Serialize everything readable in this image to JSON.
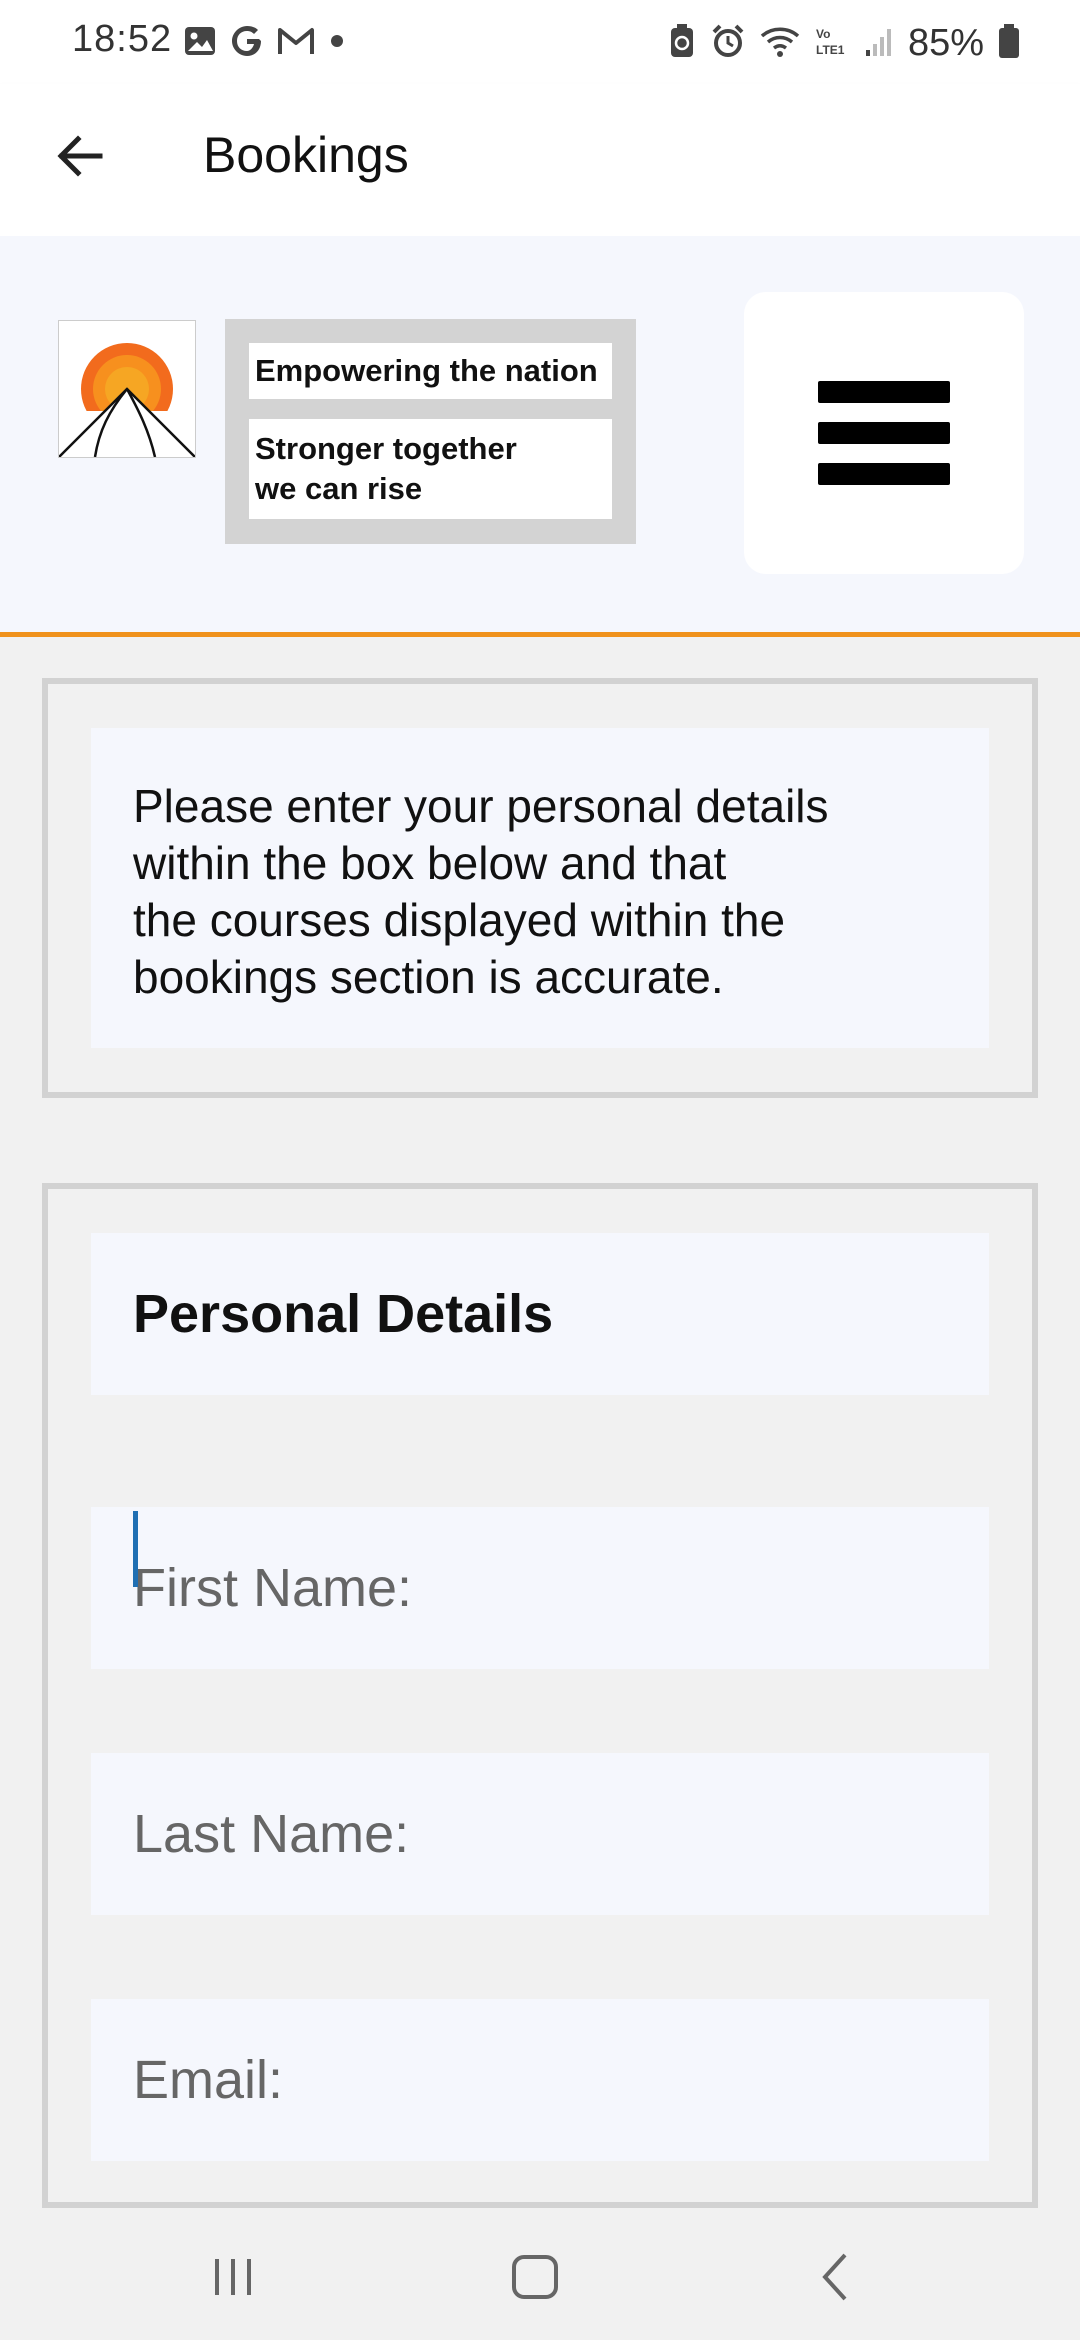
{
  "status_bar": {
    "time": "18:52",
    "left_icons": [
      "gallery-icon",
      "google-icon",
      "gmail-icon",
      "dot-icon"
    ],
    "right_icons": [
      "battery-saver-icon",
      "alarm-icon",
      "wifi-icon",
      "volte-icon",
      "signal-icon"
    ],
    "battery_percent": "85%"
  },
  "app_bar": {
    "title": "Bookings",
    "back_icon": "arrow-left-icon"
  },
  "header": {
    "logo_icon": "sunrise-mountain-logo",
    "tagline_1": "Empowering the nation",
    "tagline_2": "Stronger together\nwe can rise",
    "menu_icon": "hamburger-menu-icon"
  },
  "info": {
    "text": "Please enter your personal details\nwithin the box below and that\nthe courses displayed within the\nbookings section is accurate."
  },
  "form": {
    "heading": "Personal Details",
    "fields": [
      {
        "placeholder": "First Name:",
        "value": ""
      },
      {
        "placeholder": "Last Name:",
        "value": ""
      },
      {
        "placeholder": "Email:",
        "value": ""
      }
    ]
  },
  "nav_bar": {
    "icons": [
      "recent-apps-icon",
      "home-icon",
      "back-icon"
    ]
  },
  "colors": {
    "accent_orange": "#f0921c",
    "header_bg": "#f5f7fd",
    "panel_border": "#d2d2d2",
    "caret": "#1f6fb3"
  }
}
